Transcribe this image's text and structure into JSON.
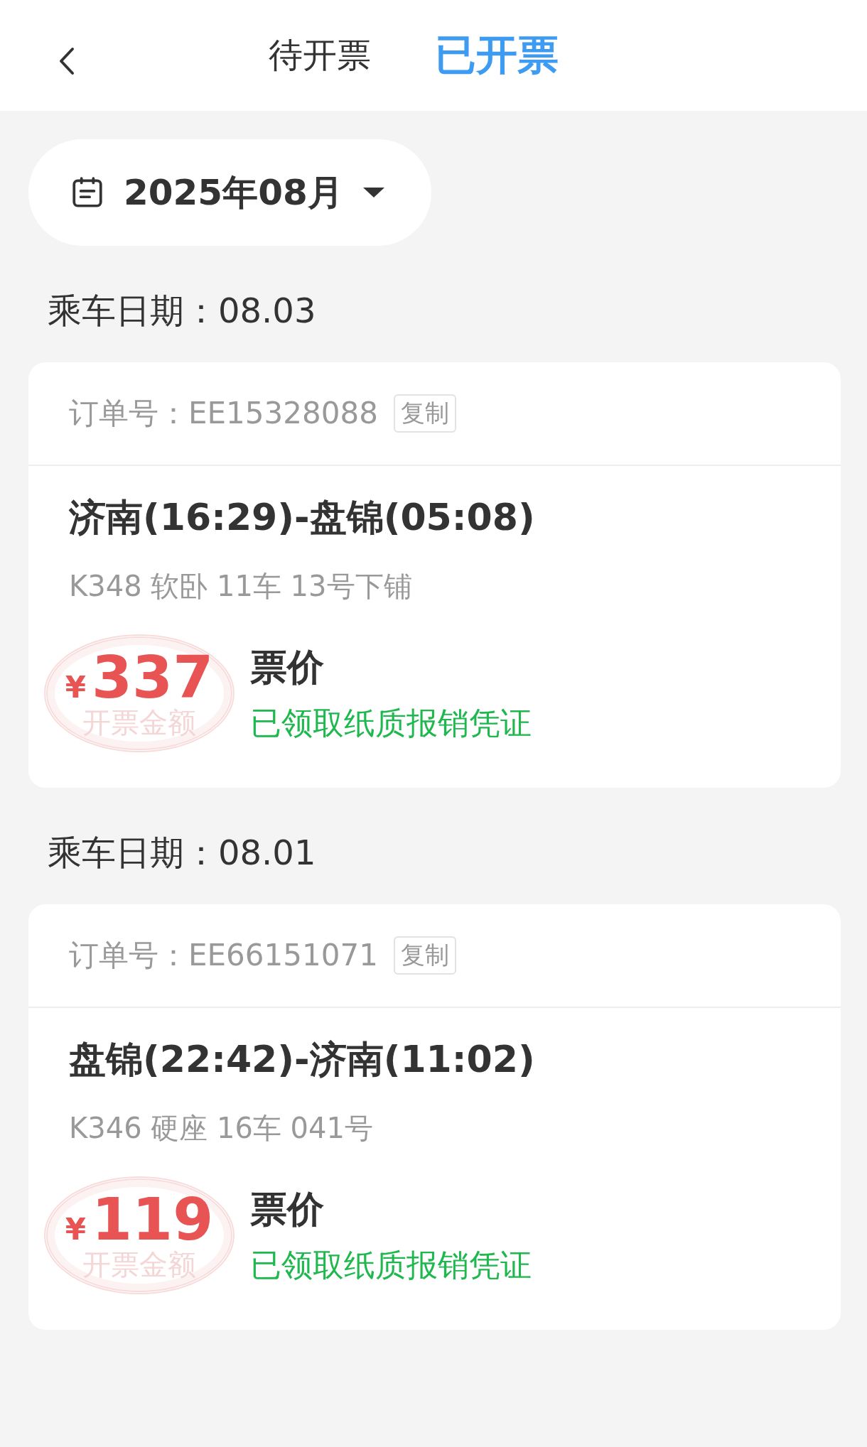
{
  "tabs": [
    {
      "label": "待开票",
      "selected": false
    },
    {
      "label": "已开票",
      "selected": true
    }
  ],
  "month_picker": {
    "value": "2025年08月"
  },
  "trips": [
    {
      "date_heading": "乘车日期：08.03",
      "order": "订单号：EE15328088",
      "copy_label": "复制",
      "route": "济南(16:29)-盘锦(05:08)",
      "seat": "K348 软卧 11车 13号下铺",
      "currency": "¥",
      "amount": "337",
      "stamp_text": "开票金额",
      "price_label": "票价",
      "status": "已领取纸质报销凭证"
    },
    {
      "date_heading": "乘车日期：08.01",
      "order": "订单号：EE66151071",
      "copy_label": "复制",
      "route": "盘锦(22:42)-济南(11:02)",
      "seat": "K346 硬座 16车 041号",
      "currency": "¥",
      "amount": "119",
      "stamp_text": "开票金额",
      "price_label": "票价",
      "status": "已领取纸质报销凭证"
    }
  ]
}
